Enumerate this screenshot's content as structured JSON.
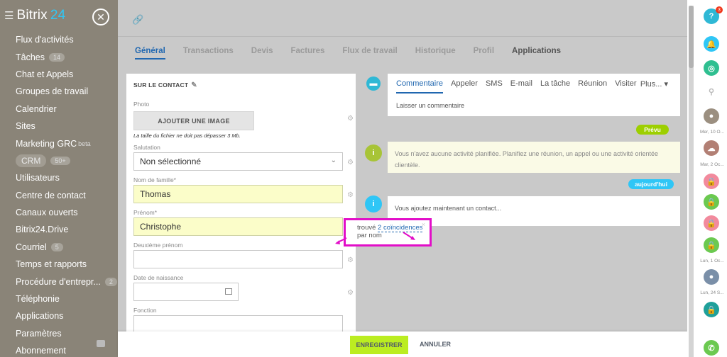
{
  "app": {
    "logo_name": "Bitrix",
    "logo_num": "24"
  },
  "sidebar": {
    "items": [
      {
        "label": "Flux d'activités"
      },
      {
        "label": "Tâches",
        "badge": "14"
      },
      {
        "label": "Chat et Appels"
      },
      {
        "label": "Groupes de travail"
      },
      {
        "label": "Calendrier"
      },
      {
        "label": "Sites"
      },
      {
        "label": "Marketing GRC",
        "beta": "beta"
      },
      {
        "label": "CRM",
        "badge": "50+"
      },
      {
        "label": "Utilisateurs"
      },
      {
        "label": "Centre de contact"
      },
      {
        "label": "Canaux ouverts"
      },
      {
        "label": "Bitrix24.Drive"
      },
      {
        "label": "Courriel",
        "badge": "5"
      },
      {
        "label": "Temps et rapports"
      },
      {
        "label": "Procédure d'entrepr...",
        "badge": "2"
      },
      {
        "label": "Téléphonie"
      },
      {
        "label": "Applications"
      },
      {
        "label": "Paramètres"
      },
      {
        "label": "Abonnement"
      }
    ]
  },
  "tabs": [
    "Général",
    "Transactions",
    "Devis",
    "Factures",
    "Flux de travail",
    "Historique",
    "Profil",
    "Applications"
  ],
  "form": {
    "title": "SUR LE CONTACT",
    "photo_label": "Photo",
    "add_image": "AJOUTER UNE IMAGE",
    "file_note": "La taille du fichier ne doit pas dépasser 3 Mb.",
    "salutation_label": "Salutation",
    "salutation_value": "Non sélectionné",
    "lastname_label": "Nom de famille*",
    "lastname_value": "Thomas",
    "firstname_label": "Prénom*",
    "firstname_value": "Christophe",
    "middlename_label": "Deuxième prénom",
    "middlename_value": "",
    "birth_label": "Date de naissance",
    "birth_value": "",
    "function_label": "Fonction",
    "function_value": ""
  },
  "tooltip": {
    "prefix": "trouvé",
    "link": "2 coïncidences",
    "suffix": "par nom",
    "close": "×"
  },
  "timeline": {
    "composer_tabs": [
      "Commentaire",
      "Appeler",
      "SMS",
      "E-mail",
      "La tâche",
      "Réunion",
      "Visiter"
    ],
    "more": "Plus... ▾",
    "placeholder": "Laisser un commentaire",
    "planned_pill": "Prévu",
    "planned_text": "Vous n'avez aucune activité planifiée. Planifiez une réunion, un appel ou une activité orientée clientèle.",
    "today_pill": "aujourd'hui",
    "today_text": "Vous ajoutez maintenant un contact..."
  },
  "rail": {
    "help_badge": "3",
    "labels": [
      "Mer, 10 O...",
      "Mar, 2 Oc...",
      "Lun, 1 Oc...",
      "Lun, 24 S..."
    ]
  },
  "footer": {
    "save": "ENREGISTRER",
    "cancel": "ANNULER"
  },
  "colors": {
    "accent": "#2067b0",
    "save": "#bbed21",
    "highlight": "#e20ec8",
    "required_bg": "#fbfdc9"
  }
}
